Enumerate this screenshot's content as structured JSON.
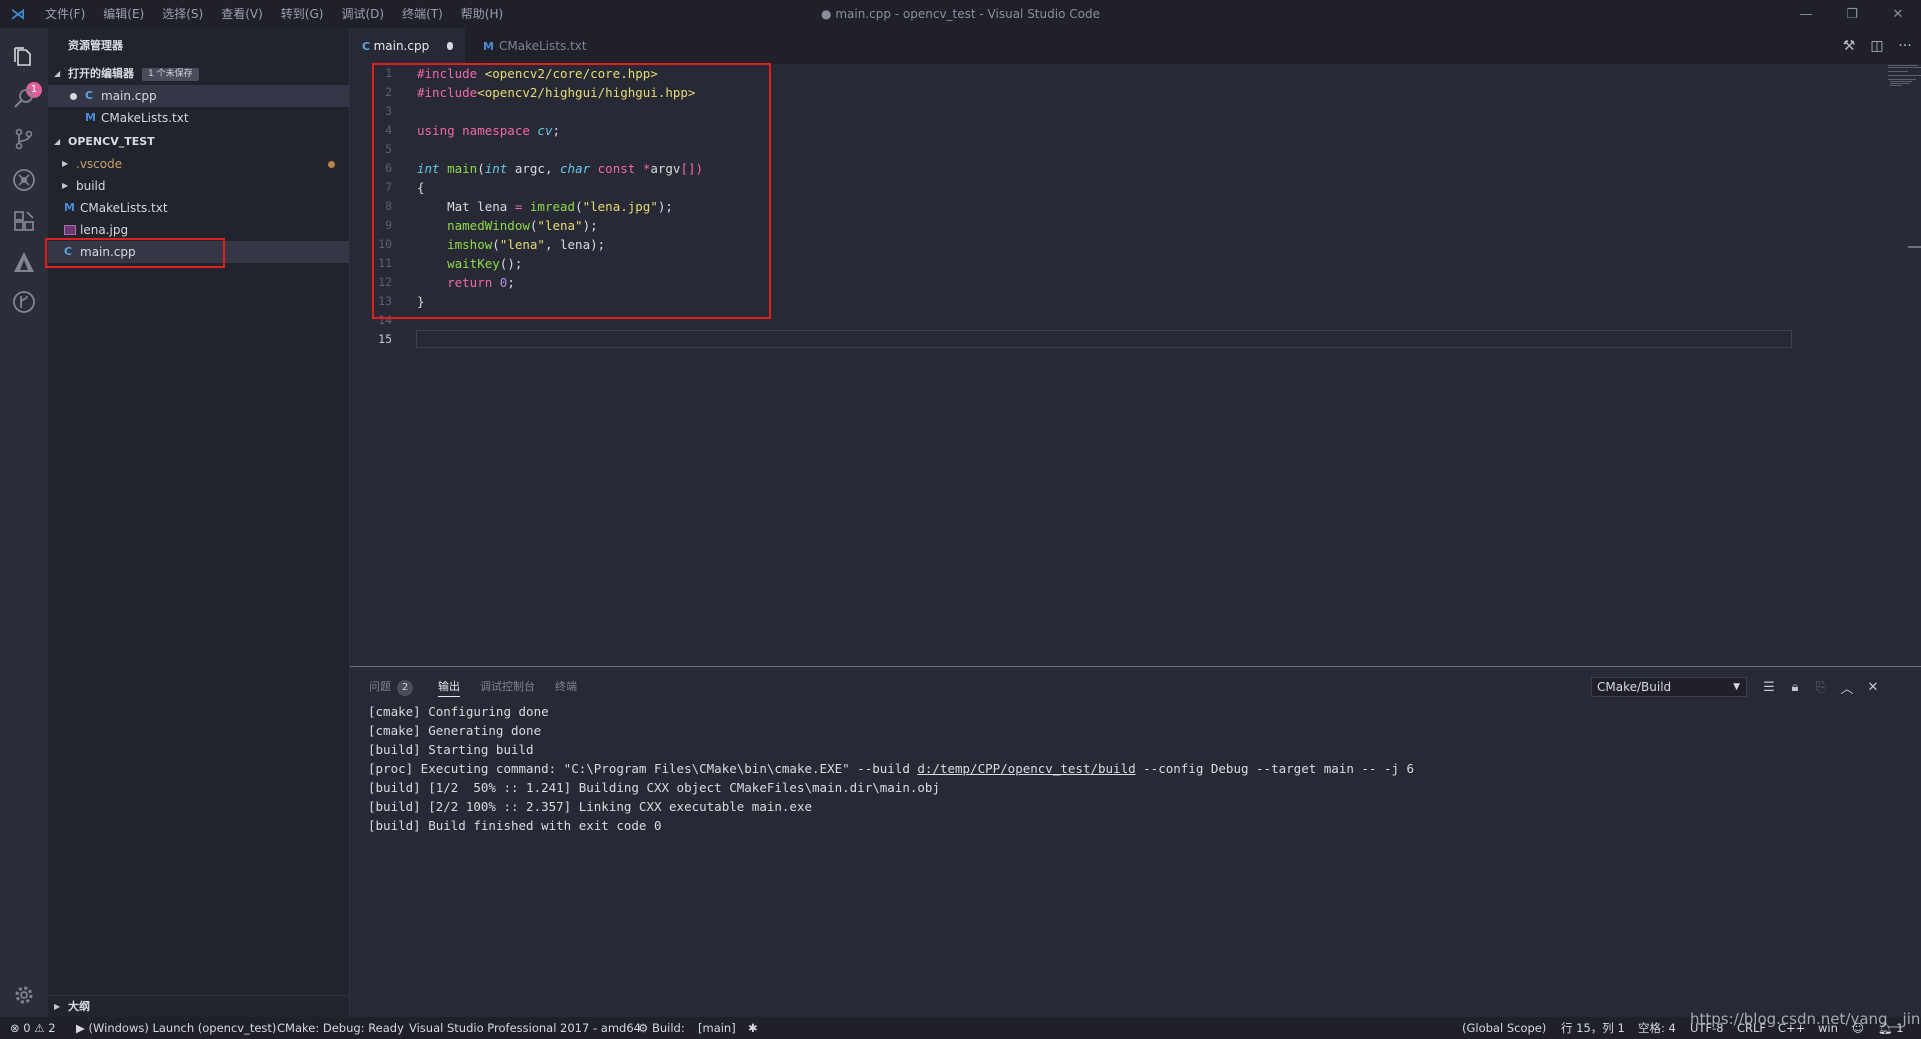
{
  "titlebar": {
    "menus": [
      "文件(F)",
      "编辑(E)",
      "选择(S)",
      "查看(V)",
      "转到(G)",
      "调试(D)",
      "终端(T)",
      "帮助(H)"
    ],
    "window_title": "● main.cpp - opencv_test - Visual Studio Code"
  },
  "activity": {
    "badge": "1"
  },
  "sidebar": {
    "title": "资源管理器",
    "open_editors": {
      "label": "打开的编辑器",
      "unsaved": "1 个未保存",
      "items": [
        "main.cpp",
        "CMakeLists.txt"
      ]
    },
    "project": {
      "label": "OPENCV_TEST",
      "items": [
        ".vscode",
        "build",
        "CMakeLists.txt",
        "lena.jpg",
        "main.cpp"
      ]
    },
    "outline": "大纲"
  },
  "tabs": [
    {
      "label": "main.cpp",
      "dirty": true
    },
    {
      "label": "CMakeLists.txt",
      "dirty": false
    }
  ],
  "editor": {
    "line_numbers": [
      "1",
      "2",
      "3",
      "4",
      "5",
      "6",
      "7",
      "8",
      "9",
      "10",
      "11",
      "12",
      "13",
      "14",
      "15"
    ],
    "code": {
      "l1_a": "#include ",
      "l1_b": "<opencv2/core/core.hpp>",
      "l2_a": "#include",
      "l2_b": "<opencv2/highgui/highgui.hpp>",
      "l4_a": "using namespace ",
      "l4_b": "cv",
      "l4_c": ";",
      "l6_a": "int",
      "l6_b": " main",
      "l6_c": "(",
      "l6_d": "int",
      "l6_e": " argc, ",
      "l6_f": "char",
      "l6_g": " const ",
      "l6_h": "*",
      "l6_i": "argv",
      "l6_j": "[])",
      "l7": "{",
      "l8_a": "    Mat lena ",
      "l8_b": "=",
      "l8_c": " imread",
      "l8_d": "(",
      "l8_e": "\"lena.jpg\"",
      "l8_f": ");",
      "l9_a": "    namedWindow",
      "l9_b": "(",
      "l9_c": "\"lena\"",
      "l9_d": ");",
      "l10_a": "    imshow",
      "l10_b": "(",
      "l10_c": "\"lena\"",
      "l10_d": ", lena);",
      "l11_a": "    waitKey",
      "l11_b": "();",
      "l12_a": "    return ",
      "l12_b": "0",
      "l12_c": ";",
      "l13": "}"
    }
  },
  "panel": {
    "tabs": [
      "问题",
      "输出",
      "调试控制台",
      "终端"
    ],
    "problems_count": "2",
    "output_channel": "CMake/Build",
    "output": {
      "l1": "[cmake] Configuring done",
      "l2": "[cmake] Generating done",
      "l3": "[build] Starting build",
      "l4_a": "[proc] Executing command: \"C:\\Program Files\\CMake\\bin\\cmake.EXE\" --build ",
      "l4_link": "d:/temp/CPP/opencv_test/build",
      "l4_b": " --config Debug --target main -- -j 6",
      "l5": "[build] [1/2  50% :: 1.241] Building CXX object CMakeFiles\\main.dir\\main.obj",
      "l6": "[build] [2/2 100% :: 2.357] Linking CXX executable main.exe",
      "l7": "[build] Build finished with exit code 0"
    }
  },
  "statusbar": {
    "errors": "0",
    "warnings": "2",
    "launch": "(Windows) Launch (opencv_test)",
    "cmake_status": "CMake: Debug: Ready",
    "kit": "Visual Studio Professional 2017 - amd64",
    "build": "Build:",
    "target": "[main]",
    "scope": "(Global Scope)",
    "position": "行 15，列 1",
    "spaces": "空格: 4",
    "encoding": "UTF-8",
    "eol": "CRLF",
    "language": "C++",
    "platform": "win",
    "notifications": "1"
  },
  "watermark": "https://blog.csdn.net/yang__jing"
}
